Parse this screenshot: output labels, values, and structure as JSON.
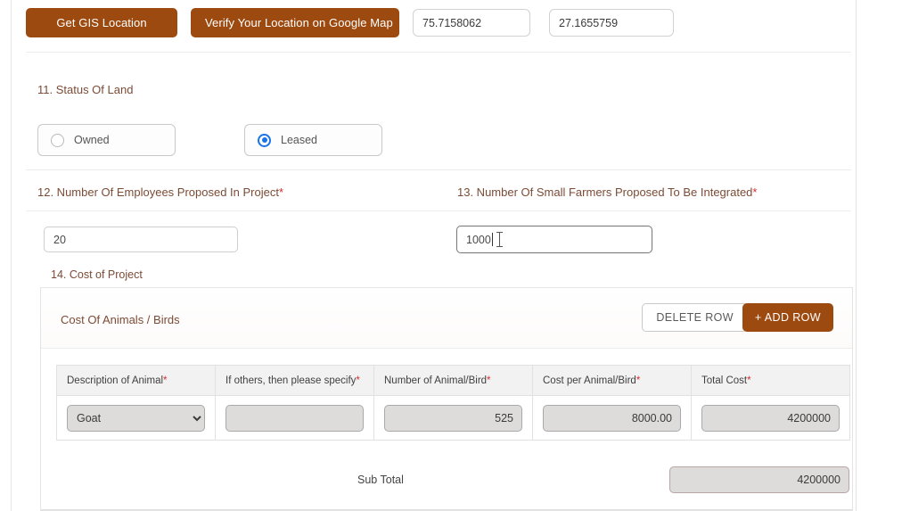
{
  "gis": {
    "get_location_button": "Get GIS Location",
    "verify_map_button": "Verify Your Location on Google Map",
    "latitude_value": "75.7158062",
    "longitude_value": "27.1655759"
  },
  "status_of_land": {
    "heading": "11. Status Of Land",
    "options": [
      {
        "label": "Owned",
        "selected": false
      },
      {
        "label": "Leased",
        "selected": true
      }
    ]
  },
  "employees": {
    "heading": "12. Number Of Employees Proposed In Project",
    "required_mark": "*",
    "value": "20"
  },
  "small_farmers": {
    "heading": "13. Number Of Small Farmers Proposed To Be Integrated",
    "required_mark": "*",
    "value": "1000",
    "focused": true
  },
  "cost_of_project": {
    "heading": "14. Cost of Project",
    "panel_title": "Cost Of Animals / Birds",
    "delete_row_button": "DELETE ROW",
    "add_row_button": "+ ADD ROW",
    "columns": [
      "Description of Animal",
      "If others, then please specify",
      "Number of Animal/Bird",
      "Cost per Animal/Bird",
      "Total Cost"
    ],
    "required_mark": "*",
    "rows": [
      {
        "description": "Goat",
        "specify": "",
        "number": "525",
        "cost_per": "8000.00",
        "total_cost": "4200000"
      }
    ],
    "subtotal_label": "Sub Total",
    "subtotal_value": "4200000"
  },
  "colors": {
    "brand_brown": "#9d4a10",
    "heading_brown": "#7b4b36",
    "required_red": "#d32f2f",
    "radio_blue": "#1a73e8",
    "field_gray": "#dedbdb"
  }
}
